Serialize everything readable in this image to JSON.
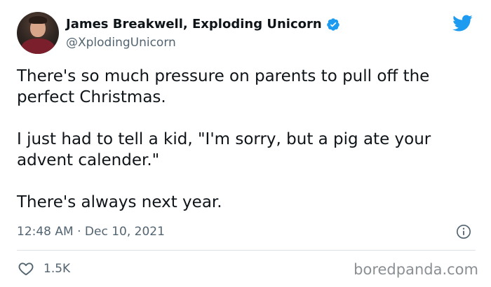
{
  "author": {
    "display_name": "James Breakwell, Exploding Unicorn",
    "handle": "@XplodingUnicorn",
    "verified": true,
    "avatar_icon": "profile-photo"
  },
  "tweet": {
    "paragraphs": [
      "There's so much pressure on parents to pull off the perfect Christmas.",
      "I just had to tell a kid, \"I'm sorry, but a pig ate your advent calender.\"",
      "There's always next year."
    ],
    "timestamp": "12:48 AM · Dec 10, 2021",
    "like_count": "1.5K"
  },
  "icons": {
    "platform": "twitter-bird-icon",
    "verified": "verified-badge-icon",
    "info": "info-icon",
    "like": "heart-icon"
  },
  "colors": {
    "brand_blue": "#1d9bf0",
    "secondary_text": "#536471",
    "primary_text": "#0f1419"
  },
  "watermark": "boredpanda.com"
}
